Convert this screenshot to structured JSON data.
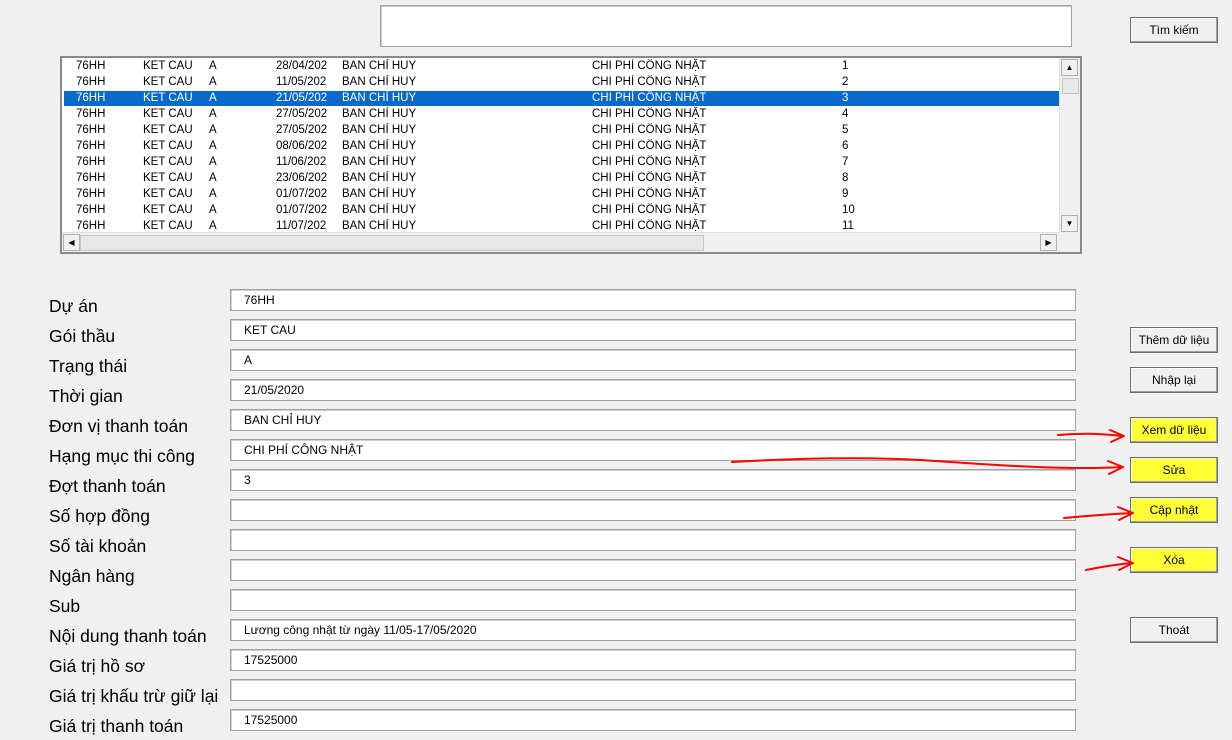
{
  "search": {
    "value": "",
    "button_label": "Tìm kiếm"
  },
  "list": {
    "rows": [
      [
        "76HH",
        "KET CAU",
        "A",
        "28/04/202",
        "BAN CHỈ HUY",
        "CHI PHÍ CÔNG NHẬT",
        "1"
      ],
      [
        "76HH",
        "KET CAU",
        "A",
        "11/05/202",
        "BAN CHỈ HUY",
        "CHI PHÍ CÔNG NHẬT",
        "2"
      ],
      [
        "76HH",
        "KET CAU",
        "A",
        "21/05/202",
        "BAN CHỈ HUY",
        "CHI PHÍ CÔNG NHẬT",
        "3"
      ],
      [
        "76HH",
        "KET CAU",
        "A",
        "27/05/202",
        "BAN CHỈ HUY",
        "CHI PHÍ CÔNG NHẬT",
        "4"
      ],
      [
        "76HH",
        "KET CAU",
        "A",
        "27/05/202",
        "BAN CHỈ HUY",
        "CHI PHÍ CÔNG NHẬT",
        "5"
      ],
      [
        "76HH",
        "KET CAU",
        "A",
        "08/06/202",
        "BAN CHỈ HUY",
        "CHI PHÍ CÔNG NHẬT",
        "6"
      ],
      [
        "76HH",
        "KET CAU",
        "A",
        "11/06/202",
        "BAN CHỈ HUY",
        "CHI PHÍ CÔNG NHẬT",
        "7"
      ],
      [
        "76HH",
        "KET CAU",
        "A",
        "23/06/202",
        "BAN CHỈ HUY",
        "CHI PHÍ CÔNG NHẬT",
        "8"
      ],
      [
        "76HH",
        "KET CAU",
        "A",
        "01/07/202",
        "BAN CHỈ HUY",
        "CHI PHÍ CÔNG NHẬT",
        "9"
      ],
      [
        "76HH",
        "KET CAU",
        "A",
        "01/07/202",
        "BAN CHỈ HUY",
        "CHI PHÍ CÔNG NHẬT",
        "10"
      ],
      [
        "76HH",
        "KET CAU",
        "A",
        "11/07/202",
        "BAN CHỈ HUY",
        "CHI PHÍ CÔNG NHẬT",
        "11"
      ]
    ],
    "selected_index": 2
  },
  "form": {
    "fields": [
      {
        "label": "Dự án",
        "value": "76HH"
      },
      {
        "label": "Gói thầu",
        "value": "KET CAU"
      },
      {
        "label": "Trạng thái",
        "value": "A"
      },
      {
        "label": "Thời gian",
        "value": "21/05/2020"
      },
      {
        "label": "Đơn vị thanh toán",
        "value": "BAN CHỈ HUY"
      },
      {
        "label": "Hạng mục thi công",
        "value": "CHI PHÍ CÔNG NHẬT"
      },
      {
        "label": "Đợt thanh toán",
        "value": "3"
      },
      {
        "label": "Số hợp đồng",
        "value": ""
      },
      {
        "label": "Số tài khoản",
        "value": ""
      },
      {
        "label": "Ngân hàng",
        "value": ""
      },
      {
        "label": "Sub",
        "value": ""
      },
      {
        "label": "Nội dung thanh toán",
        "value": "Lương công nhật từ ngày 11/05-17/05/2020"
      },
      {
        "label": "Giá trị hồ sơ",
        "value": "17525000"
      },
      {
        "label": "Giá trị khấu trừ giữ lại",
        "value": ""
      },
      {
        "label": "Giá trị thanh toán",
        "value": "17525000"
      }
    ]
  },
  "buttons": {
    "add": "Thêm dữ liệu",
    "reset": "Nhập lại",
    "view": "Xem dữ liệu",
    "edit": "Sửa",
    "update": "Cập nhật",
    "delete": "Xóa",
    "exit": "Thoát"
  },
  "colors": {
    "selection": "#0a6acb",
    "highlight": "#ffff33",
    "annotation": "#ff0000"
  }
}
